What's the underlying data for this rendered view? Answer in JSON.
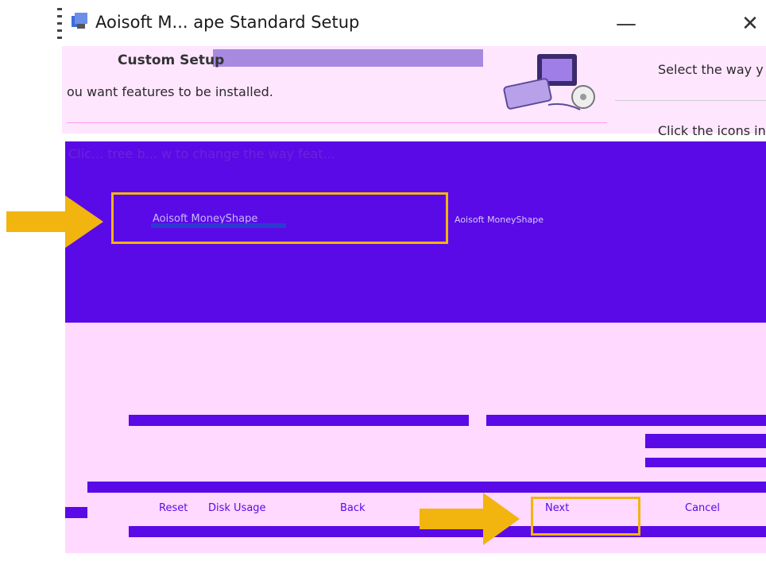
{
  "window": {
    "title": "Aoisoft MoneyShape Standard Setup",
    "title_visible": "Aoisoft M... ape Standard Setup",
    "minimize_glyph": "—",
    "close_glyph": "✕"
  },
  "banner": {
    "title": "Custom Setup",
    "subtitle": "ou want features to be installed.",
    "right_line1": "Select the way y",
    "right_line2": "Click the icons in"
  },
  "tree": {
    "hint": "Click the icons in the tree below to change the way features will be installed.",
    "hint_visible": "Clic... tree b... w to change the way feat...",
    "selected_item": "Aoisoft MoneyShape",
    "description": "Aoisoft MoneyShape"
  },
  "buttons": {
    "reset": "Reset",
    "disk_usage": "Disk Usage",
    "back": "Back",
    "next": "Next",
    "cancel": "Cancel"
  },
  "colors": {
    "accent": "#5a0ae6",
    "banner_bg": "#ffe6ff",
    "body_bg": "#ffd9ff",
    "highlight": "#f2b40f"
  },
  "icons": [
    "installer-icon",
    "minimize-icon",
    "close-icon",
    "computer-setup-icon",
    "arrow-icon"
  ]
}
